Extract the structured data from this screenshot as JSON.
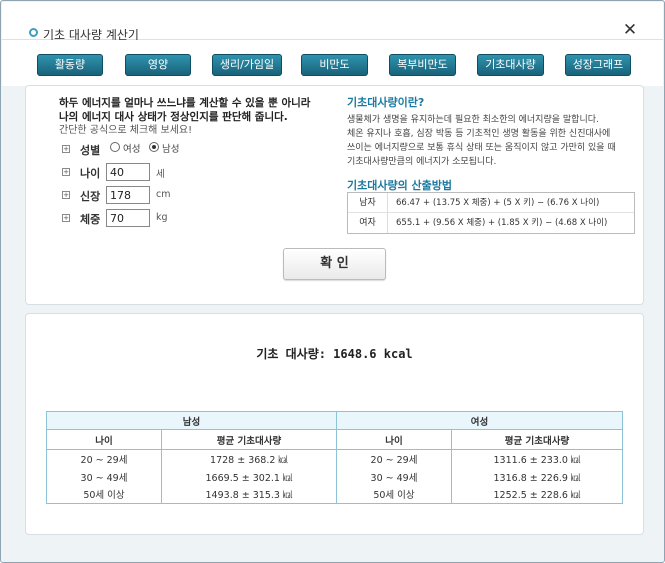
{
  "window": {
    "title": "기초 대사량 계산기",
    "close_label": "✕"
  },
  "tabs": [
    {
      "label": "활동량"
    },
    {
      "label": "영양"
    },
    {
      "label": "생리/가임일"
    },
    {
      "label": "비만도"
    },
    {
      "label": "복부비만도"
    },
    {
      "label": "기초대사량"
    },
    {
      "label": "성장그래프"
    }
  ],
  "intro": {
    "line1": "하두 에너지를 얼마나 쓰느냐를 계산할 수 있을 뿐 아니라",
    "line2": "나의 에너지 대사 상태가 정상인지를 판단해 줍니다.",
    "line3": "간단한 공식으로 체크해 보세요!"
  },
  "form": {
    "sex_label": "성별",
    "female_label": "여성",
    "male_label": "남성",
    "age_label": "나이",
    "age_value": "40",
    "age_unit": "세",
    "height_label": "신장",
    "height_value": "178",
    "height_unit": "cm",
    "weight_label": "체중",
    "weight_value": "70",
    "weight_unit": "kg"
  },
  "info": {
    "what_title": "기초대사량이란?",
    "what_lines": [
      "생물체가 생명을 유지하는데 필요한 최소한의 에너지량을 말합니다.",
      "체온 유지나 호흡, 심장 박동 등 기초적인 생명 활동을 위한 신진대사에",
      "쓰이는 에너지량으로 보통 휴식 상태 또는 움직이지 않고 가만히 있을 때",
      "기초대사량만큼의 에너지가 소모됩니다."
    ],
    "method_title": "기초대사량의 산출방법",
    "formulas": [
      {
        "sex": "남자",
        "equation": "66.47 + (13.75 X 체중) + (5 X 키) − (6.76 X 나이)"
      },
      {
        "sex": "여자",
        "equation": "655.1 + (9.56 X 체중) + (1.85 X 키) − (4.68 X 나이)"
      }
    ]
  },
  "confirm_label": "확 인",
  "result": {
    "text": "기초 대사량: 1648.6 kcal"
  },
  "table": {
    "male_header": "남성",
    "female_header": "여성",
    "age_header": "나이",
    "avg_header": "평균 기초대사량",
    "rows": [
      {
        "male_age": "20 ~ 29세",
        "male_avg": "1728 ± 368.2 ㎉",
        "female_age": "20 ~ 29세",
        "female_avg": "1311.6 ± 233.0 ㎉"
      },
      {
        "male_age": "30 ~ 49세",
        "male_avg": "1669.5 ± 302.1 ㎉",
        "female_age": "30 ~ 49세",
        "female_avg": "1316.8 ± 226.9 ㎉"
      },
      {
        "male_age": "50세 이상",
        "male_avg": "1493.8 ± 315.3 ㎉",
        "female_age": "50세 이상",
        "female_avg": "1252.5 ± 228.6 ㎉"
      }
    ]
  }
}
